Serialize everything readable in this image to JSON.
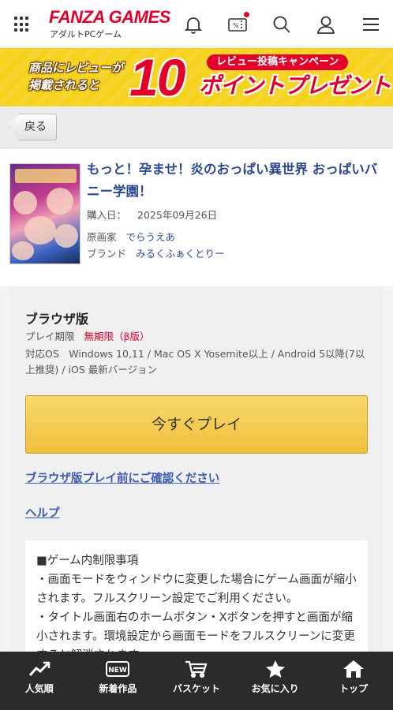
{
  "header": {
    "logo": "FANZA GAMES",
    "logo_sub": "アダルトPCゲーム"
  },
  "banner": {
    "left_line1": "商品にレビューが",
    "left_line2": "掲載されると",
    "big_number": "10",
    "pill": "レビュー投稿キャンペーン",
    "right_text": "ポイントプレゼント"
  },
  "back_button": "戻る",
  "product": {
    "title": "もっと！孕ませ！炎のおっぱい異世界 おっぱいバニー学園！",
    "purchase_label": "購入日：",
    "purchase_date": "2025年09月26日",
    "artist_label": "原画家",
    "artist": "でらうえあ",
    "brand_label": "ブランド",
    "brand": "みるくふぁくとりー"
  },
  "play": {
    "title": "ブラウザ版",
    "period_label": "プレイ期限",
    "period_value": "無期限（β版）",
    "os_text": "対応OS　Windows 10,11 / Mac OS X Yosemite以上 / Android 5以降(7以上推奨) / iOS 最新バージョン",
    "play_button": "今すぐプレイ",
    "confirm_link": "ブラウザ版プレイ前にご確認ください",
    "help_link": "ヘルプ",
    "note_title": "■ゲーム内制限事項",
    "note_1": "・画面モードをウィンドウに変更した場合にゲーム画面が縮小されます。フルスクリーン設定でご利用ください。",
    "note_2": "・タイトル画面右のホームボタン・Xボタンを押すと画面が縮小されます。環境設定から画面モードをフルスクリーンに変更すると解消されます。"
  },
  "bottom_nav": {
    "popular": "人気順",
    "new": "新着作品",
    "basket": "バスケット",
    "favorites": "お気に入り",
    "top": "トップ"
  },
  "colors": {
    "brand_red": "#e2002b",
    "link_blue": "#2e4a8f",
    "play_button": "#f0c03a",
    "nav_bg": "#2b2b2b"
  }
}
